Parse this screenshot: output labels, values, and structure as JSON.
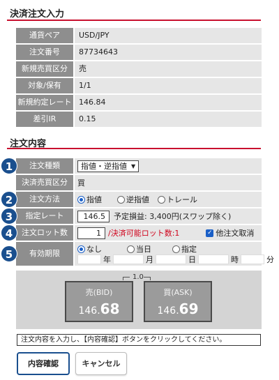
{
  "settlement": {
    "title": "決済注文入力",
    "rows": [
      {
        "label": "通貨ペア",
        "value": "USD/JPY"
      },
      {
        "label": "注文番号",
        "value": "87734643"
      },
      {
        "label": "新規売買区分",
        "value": "売"
      },
      {
        "label": "対象/保有",
        "value": "1/1"
      },
      {
        "label": "新規約定レート",
        "value": "146.84"
      },
      {
        "label": "差引IR",
        "value": "0.15"
      }
    ]
  },
  "order": {
    "title": "注文内容",
    "type": {
      "badge": "1",
      "label": "注文種類",
      "selected": "指値・逆指値"
    },
    "side": {
      "label": "決済売買区分",
      "value": "買"
    },
    "method": {
      "badge": "2",
      "label": "注文方法",
      "options": [
        "指値",
        "逆指値",
        "トレール"
      ],
      "selected": "指値"
    },
    "rate": {
      "badge": "3",
      "label": "指定レート",
      "value": "146.5",
      "pl_text": "予定損益: 3,400円(スワップ除く)"
    },
    "lot": {
      "badge": "4",
      "label": "注文ロット数",
      "value": "1",
      "available": "/決済可能ロット数:1",
      "cancel_other": "他注文取消",
      "cancel_other_checked": true
    },
    "expiry": {
      "badge": "5",
      "label": "有効期限",
      "options": [
        "なし",
        "当日",
        "指定"
      ],
      "selected": "なし",
      "units": [
        "年",
        "月",
        "日",
        "時",
        "分"
      ]
    }
  },
  "price": {
    "spread": "1.0",
    "bid": {
      "label": "売(BID)",
      "prefix": "146.",
      "big": "68"
    },
    "ask": {
      "label": "買(ASK)",
      "prefix": "146.",
      "big": "69"
    }
  },
  "message": "注文内容を入力し、【内容確認】ボタンをクリックしてください。",
  "buttons": {
    "confirm": "内容確認",
    "cancel": "キャンセル"
  },
  "colors": {
    "accent_line": "#c8102e",
    "badge": "#1a4f8e",
    "label_bg": "#8e8e8e",
    "value_bg": "#e6e6e6",
    "red_text": "#d0021b"
  }
}
